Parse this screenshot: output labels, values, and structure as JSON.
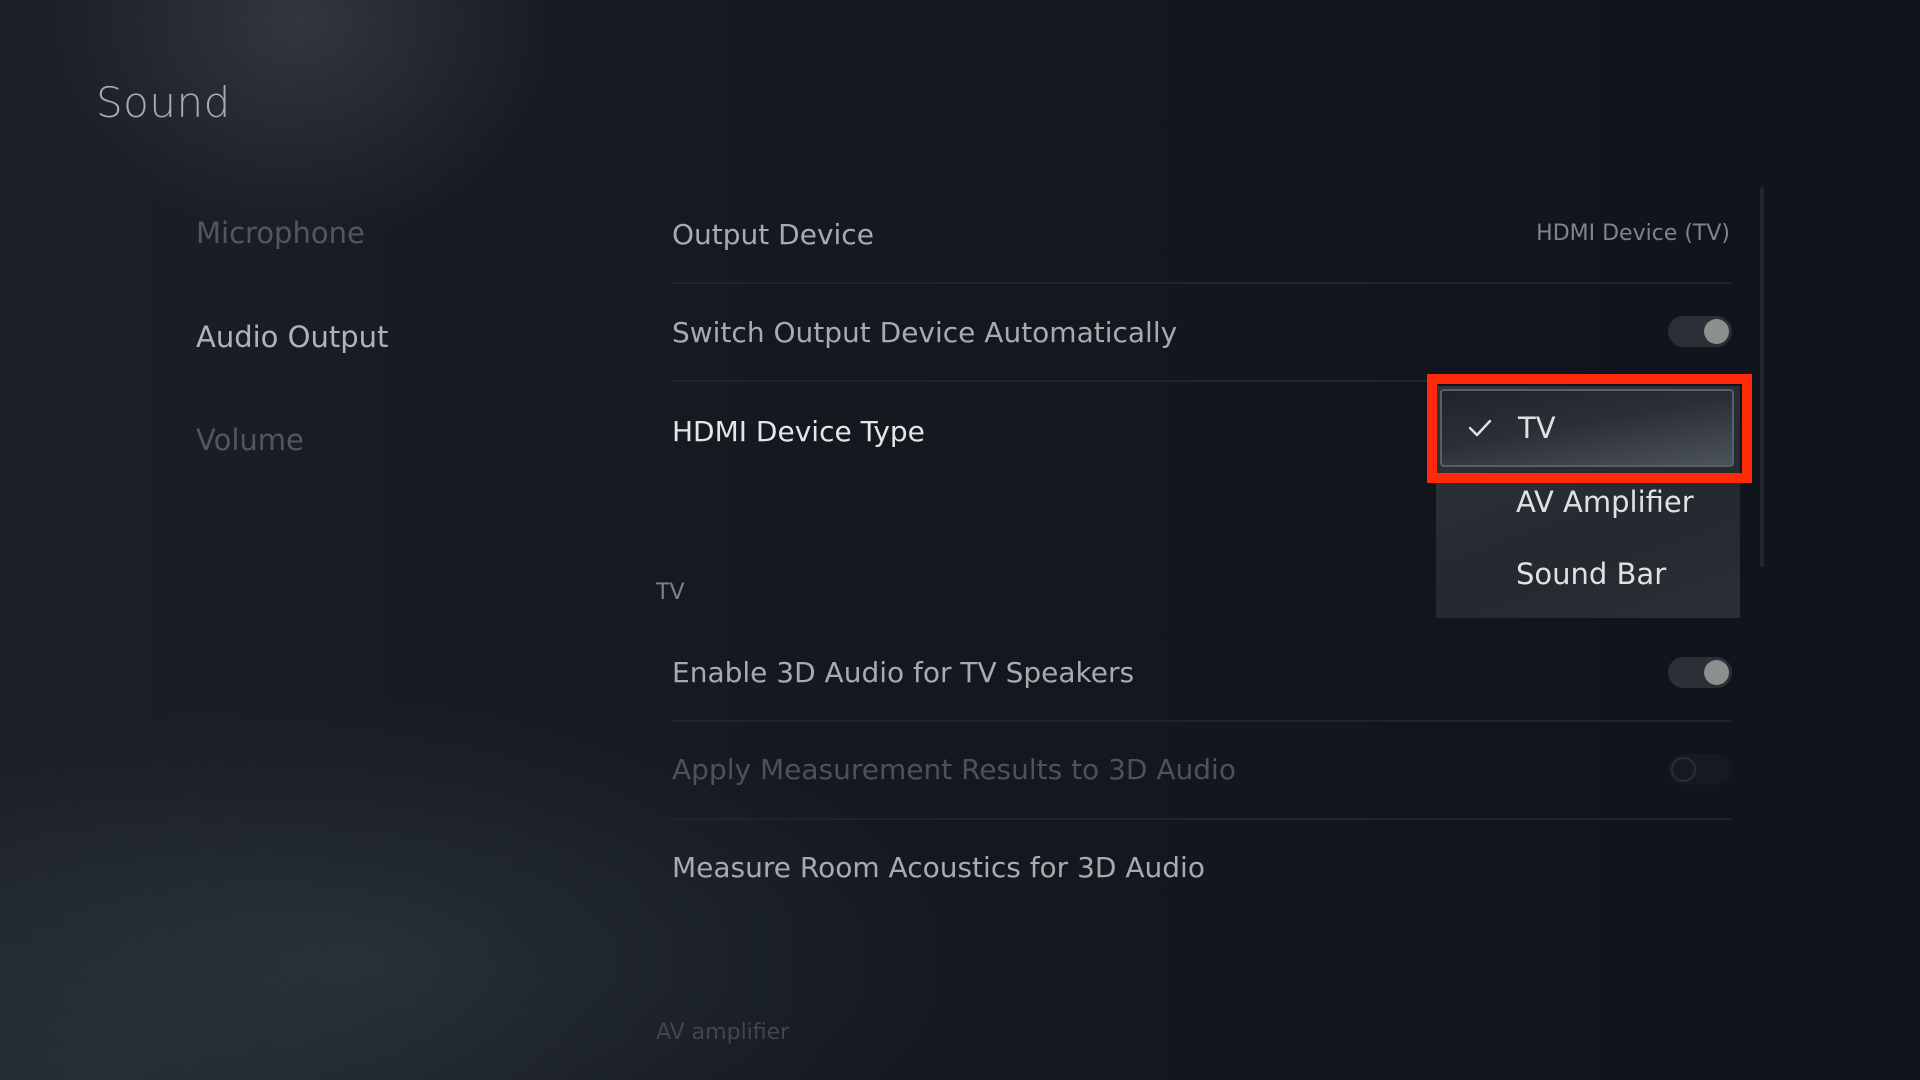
{
  "header": {
    "title": "Sound"
  },
  "sidebar": {
    "items": [
      {
        "label": "Microphone",
        "active": false
      },
      {
        "label": "Audio Output",
        "active": true
      },
      {
        "label": "Volume",
        "active": false
      }
    ]
  },
  "settings": {
    "output_device": {
      "label": "Output Device",
      "value": "HDMI Device (TV)"
    },
    "switch_auto": {
      "label": "Switch Output Device Automatically",
      "on": true
    },
    "hdmi_type": {
      "label": "HDMI Device Type",
      "options": [
        "TV",
        "AV Amplifier",
        "Sound Bar"
      ],
      "selected": "TV"
    },
    "section_tv": "TV",
    "enable_3d": {
      "label": "Enable 3D Audio for TV Speakers",
      "on": true
    },
    "apply_measurement": {
      "label": "Apply Measurement Results to 3D Audio",
      "on": false,
      "disabled": true
    },
    "measure_room": {
      "label": "Measure Room Acoustics for 3D Audio"
    },
    "section_av": "AV amplifier"
  },
  "annotation": {
    "highlight_color": "#ff2a0a"
  }
}
